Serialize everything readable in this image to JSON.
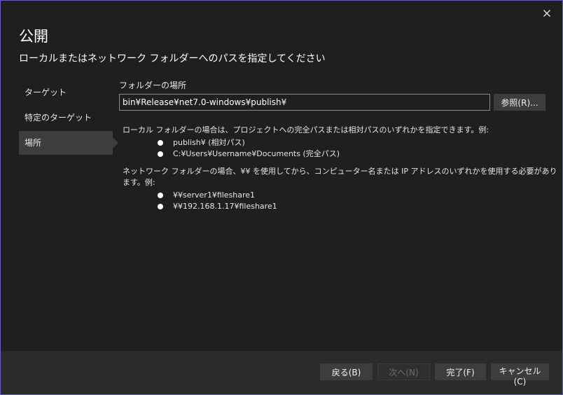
{
  "dialog": {
    "title": "公開",
    "subtitle": "ローカルまたはネットワーク フォルダーへのパスを指定してください",
    "close_icon": "close-icon"
  },
  "nav": {
    "items": [
      {
        "label": "ターゲット",
        "active": false
      },
      {
        "label": "特定のターゲット",
        "active": false
      },
      {
        "label": "場所",
        "active": true
      }
    ]
  },
  "location": {
    "label": "フォルダーの場所",
    "value": "bin¥Release¥net7.0-windows¥publish¥",
    "browse_label": "参照(R)..."
  },
  "info": {
    "local": {
      "text": "ローカル フォルダーの場合は、プロジェクトへの完全パスまたは相対パスのいずれかを指定できます。例:",
      "examples": [
        "publish¥ (相対パス)",
        "C:¥Users¥Username¥Documents (完全パス)"
      ]
    },
    "network": {
      "text": "ネットワーク フォルダーの場合、¥¥ を使用してから、コンピューター名または IP アドレスのいずれかを使用する必要があります。例:",
      "examples": [
        "¥¥server1¥fileshare1",
        "¥¥192.168.1.17¥fileshare1"
      ]
    }
  },
  "footer": {
    "back_label": "戻る(B)",
    "next_label": "次へ(N)",
    "finish_label": "完了(F)",
    "cancel_label": "キャンセル(C)"
  },
  "colors": {
    "background": "#1f1f1f",
    "window_border": "#6b5fc6",
    "button": "#3d3d3d",
    "footer": "#2b2b2b"
  }
}
